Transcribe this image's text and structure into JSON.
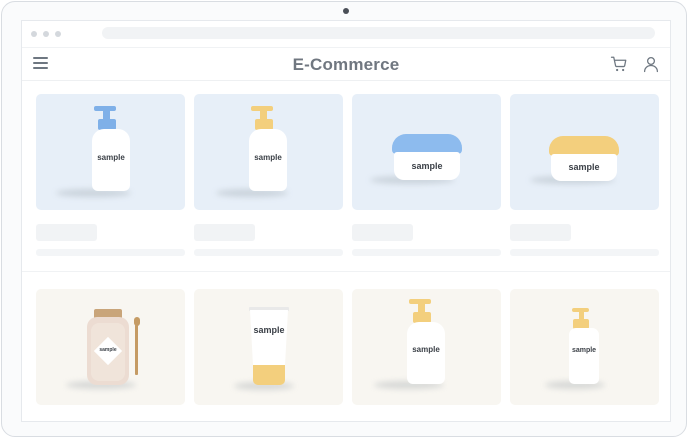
{
  "header": {
    "brand": "E-Commerce"
  },
  "icons": {
    "menu": "hamburger-menu-icon",
    "cart": "shopping-cart-icon",
    "user": "user-account-icon"
  },
  "colors": {
    "card_bg_row1": "#e7eff8",
    "card_bg_row2": "#f8f6f1",
    "brand_text": "#707780",
    "accent_blue": "#7fb0e8",
    "accent_yellow": "#f3cf7d"
  },
  "products": {
    "row1": [
      {
        "type": "foam-pump-bottle",
        "cap": "blue",
        "label": "sample"
      },
      {
        "type": "foam-pump-bottle",
        "cap": "yellow",
        "label": "sample"
      },
      {
        "type": "cream-jar",
        "cap": "blue",
        "label": "sample"
      },
      {
        "type": "cream-jar",
        "cap": "yellow",
        "label": "sample"
      }
    ],
    "row2": [
      {
        "type": "bath-salt-jar",
        "cap": "cork",
        "label": "sample"
      },
      {
        "type": "squeeze-tube",
        "cap": "yellow",
        "label": "sample"
      },
      {
        "type": "foam-pump-bottle",
        "cap": "yellow",
        "label": "sample"
      },
      {
        "type": "pump-bottle-small",
        "cap": "yellow",
        "label": "sample"
      }
    ]
  }
}
